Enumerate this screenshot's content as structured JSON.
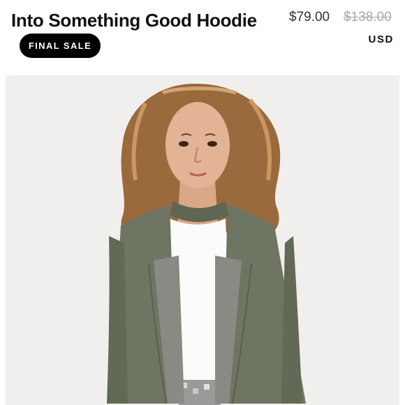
{
  "product": {
    "title": "Into Something Good Hoodie",
    "badge": "FINAL SALE",
    "price_current": "$79.00",
    "price_original": "$138.00",
    "currency": "USD"
  },
  "colors": {
    "badge_bg": "#000000",
    "background": "#f1efed",
    "jacket": "#6e7563"
  }
}
